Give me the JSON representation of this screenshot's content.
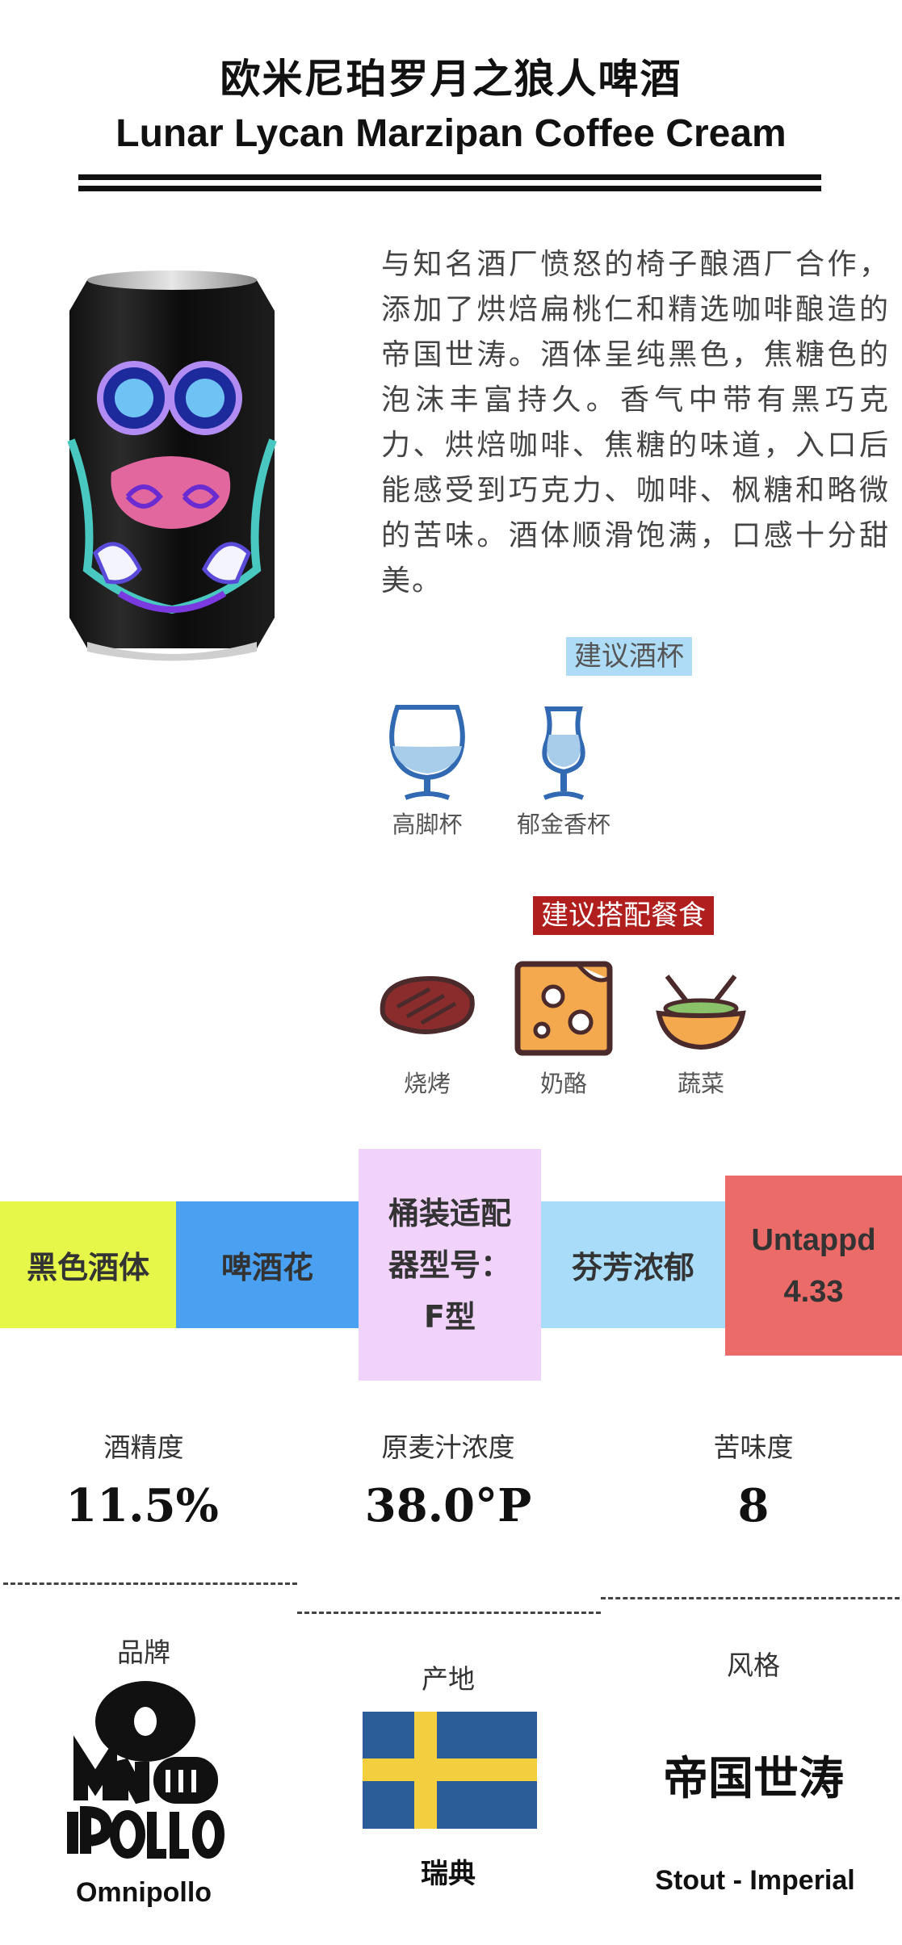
{
  "header": {
    "title_cn": "欧米尼珀罗月之狼人啤酒",
    "title_en": "Lunar Lycan Marzipan Coffee Cream"
  },
  "description": "与知名酒厂愤怒的椅子酿酒厂合作，添加了烘焙扁桃仁和精选咖啡酿造的帝国世涛。酒体呈纯黑色，焦糖色的泡沫丰富持久。香气中带有黑巧克力、烘焙咖啡、焦糖的味道，入口后能感受到巧克力、咖啡、枫糖和略微的苦味。酒体顺滑饱满，口感十分甜美。",
  "glassware": {
    "title": "建议酒杯",
    "items": [
      {
        "label": "高脚杯",
        "icon": "snifter-glass-icon"
      },
      {
        "label": "郁金香杯",
        "icon": "tulip-glass-icon"
      }
    ]
  },
  "food": {
    "title": "建议搭配餐食",
    "items": [
      {
        "label": "烧烤",
        "icon": "steak-icon"
      },
      {
        "label": "奶酪",
        "icon": "cheese-icon"
      },
      {
        "label": "蔬菜",
        "icon": "salad-bowl-icon"
      }
    ]
  },
  "band": {
    "body": "黑色酒体",
    "hops": "啤酒花",
    "keg_line1": "桶装适配",
    "keg_line2": "器型号：",
    "keg_line3": "F型",
    "aroma": "芬芳浓郁",
    "untappd_label": "Untappd",
    "untappd_score": "4.33",
    "colors": {
      "body": "#e6f74a",
      "hops": "#4aa1f2",
      "keg": "#f0d2fa",
      "aroma": "#a9dcf8",
      "untappd": "#ea6b67"
    }
  },
  "stats": {
    "abv_label": "酒精度",
    "abv_value": "11.5%",
    "og_label": "原麦汁浓度",
    "og_value": "38.0°P",
    "ibu_label": "苦味度",
    "ibu_value": "8"
  },
  "footer": {
    "brand_label": "品牌",
    "brand_name": "Omnipollo",
    "origin_label": "产地",
    "origin_name": "瑞典",
    "style_label": "风格",
    "style_cn": "帝国世涛",
    "style_en": "Stout - Imperial"
  }
}
